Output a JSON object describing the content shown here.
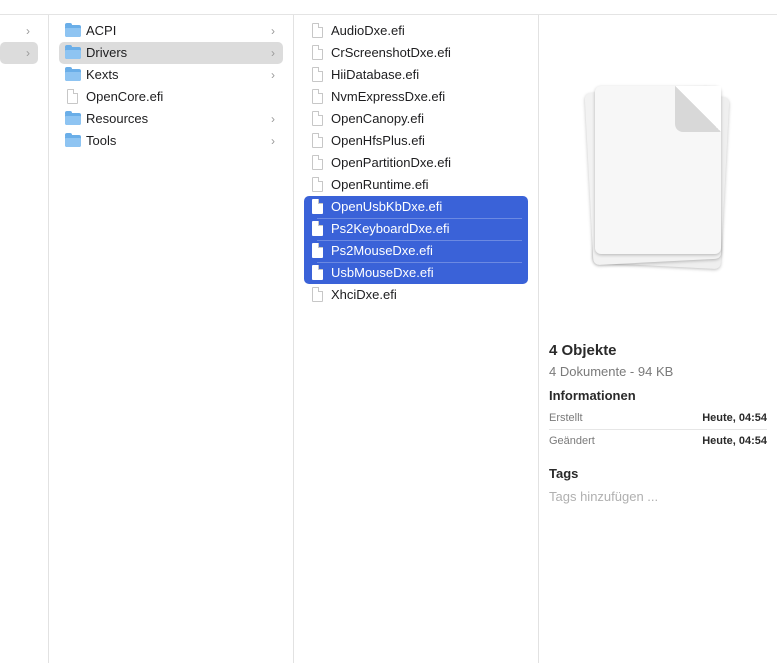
{
  "column0": {
    "chevrons": [
      "›",
      "›"
    ]
  },
  "column1": {
    "items": [
      {
        "label": "ACPI",
        "type": "folder",
        "chevron": "›"
      },
      {
        "label": "Drivers",
        "type": "folder",
        "chevron": "›"
      },
      {
        "label": "Kexts",
        "type": "folder",
        "chevron": "›"
      },
      {
        "label": "OpenCore.efi",
        "type": "file",
        "chevron": ""
      },
      {
        "label": "Resources",
        "type": "folder",
        "chevron": "›"
      },
      {
        "label": "Tools",
        "type": "folder",
        "chevron": "›"
      }
    ]
  },
  "column2": {
    "items": [
      {
        "label": "AudioDxe.efi"
      },
      {
        "label": "CrScreenshotDxe.efi"
      },
      {
        "label": "HiiDatabase.efi"
      },
      {
        "label": "NvmExpressDxe.efi"
      },
      {
        "label": "OpenCanopy.efi"
      },
      {
        "label": "OpenHfsPlus.efi"
      },
      {
        "label": "OpenPartitionDxe.efi"
      },
      {
        "label": "OpenRuntime.efi"
      },
      {
        "label": "OpenUsbKbDxe.efi"
      },
      {
        "label": "Ps2KeyboardDxe.efi"
      },
      {
        "label": "Ps2MouseDxe.efi"
      },
      {
        "label": "UsbMouseDxe.efi"
      },
      {
        "label": "XhciDxe.efi"
      }
    ]
  },
  "preview": {
    "title": "4 Objekte",
    "subtitle": "4 Dokumente - 94 KB",
    "info_heading": "Informationen",
    "created_label": "Erstellt",
    "created_value": "Heute, 04:54",
    "modified_label": "Geändert",
    "modified_value": "Heute, 04:54",
    "tags_heading": "Tags",
    "tags_placeholder": "Tags hinzufügen ..."
  },
  "colors": {
    "selection": "#3a62d8",
    "folder": "#6aaee8"
  },
  "icons": {
    "folder": "folder-icon",
    "file": "document-icon",
    "chevron": "chevron-right-icon"
  }
}
